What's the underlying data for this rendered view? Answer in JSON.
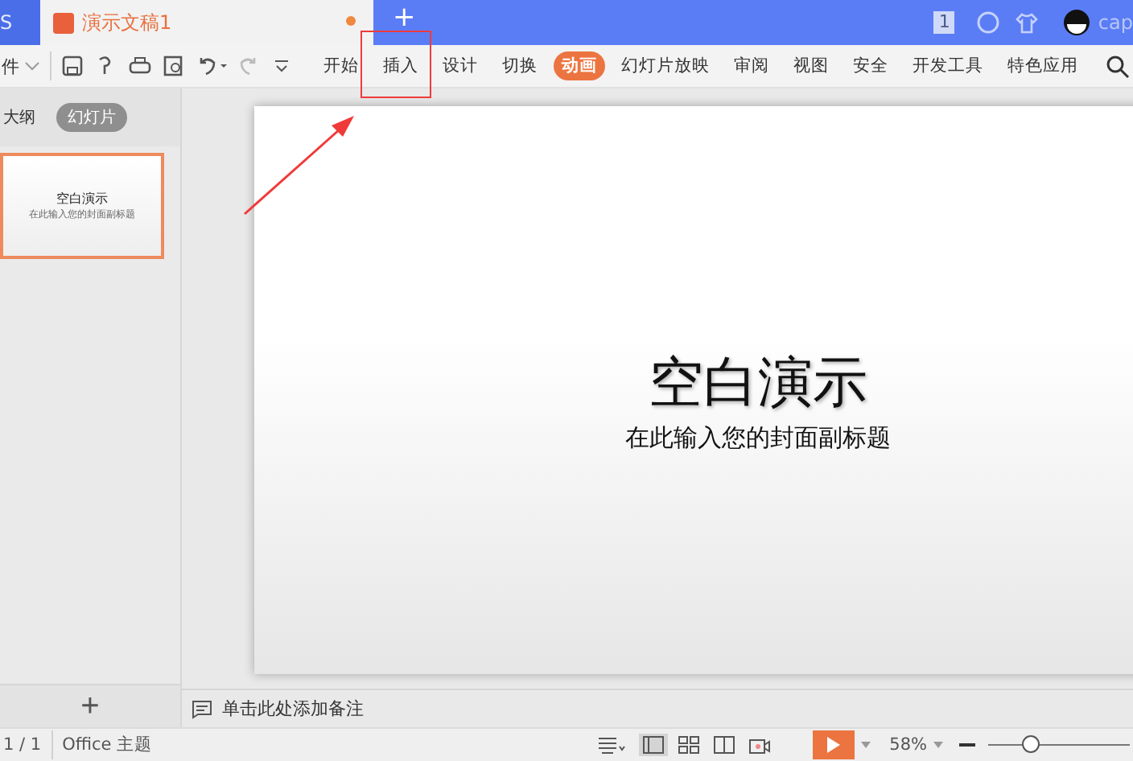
{
  "title_bar": {
    "tabs": [
      {
        "label": "S",
        "selected": false
      },
      {
        "label": "演示文稿1",
        "selected": true,
        "unsaved": true
      }
    ],
    "new_tab": "+",
    "badge": "1",
    "account": "cap"
  },
  "toolbar": {
    "file_menu": "件",
    "ribbon_tabs": [
      {
        "label": "开始",
        "selected": false
      },
      {
        "label": "插入",
        "selected": false
      },
      {
        "label": "设计",
        "selected": false
      },
      {
        "label": "切换",
        "selected": false
      },
      {
        "label": "动画",
        "selected": true
      },
      {
        "label": "幻灯片放映",
        "selected": false
      },
      {
        "label": "审阅",
        "selected": false
      },
      {
        "label": "视图",
        "selected": false
      },
      {
        "label": "安全",
        "selected": false
      },
      {
        "label": "开发工具",
        "selected": false
      },
      {
        "label": "特色应用",
        "selected": false
      }
    ]
  },
  "left_panel": {
    "tabs": [
      {
        "label": "大纲",
        "selected": false
      },
      {
        "label": "幻灯片",
        "selected": true
      }
    ],
    "thumbnails": [
      {
        "title": "空白演示",
        "subtitle": "在此输入您的封面副标题",
        "selected": true
      }
    ],
    "add": "+"
  },
  "slide": {
    "title": "空白演示",
    "subtitle": "在此输入您的封面副标题"
  },
  "notes": {
    "placeholder": "单击此处添加备注"
  },
  "status_bar": {
    "page": "1 / 1",
    "theme": "Office 主题",
    "zoom": "58%",
    "zoom_slider": {
      "level": 0.3
    },
    "views": [
      {
        "kind": "normal",
        "selected": true
      },
      {
        "kind": "sorter",
        "selected": false
      },
      {
        "kind": "reading",
        "selected": false
      },
      {
        "kind": "record",
        "selected": false
      }
    ]
  },
  "annotation": {
    "highlight": true,
    "arrow": true
  }
}
